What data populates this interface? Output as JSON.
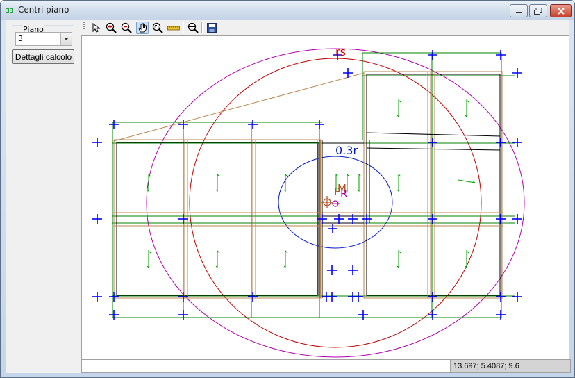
{
  "window": {
    "title": "Centri piano",
    "icon": "app-icon",
    "controls": [
      "minimize-icon",
      "restore-icon",
      "close-icon"
    ]
  },
  "left_panel": {
    "group_label": "Piano",
    "floor_select_value": "3",
    "calc_button_label": "Dettagli calcolo"
  },
  "toolbar": {
    "tools": [
      {
        "name": "select-arrow-icon",
        "active": false
      },
      {
        "name": "zoom-in-icon",
        "active": false
      },
      {
        "name": "zoom-out-icon",
        "active": false
      },
      {
        "name": "pan-hand-icon",
        "active": true
      },
      {
        "name": "zoom-window-icon",
        "active": false
      },
      {
        "name": "measure-ruler-icon",
        "active": false
      },
      {
        "name": "zoom-extents-icon",
        "active": false
      },
      {
        "name": "save-icon",
        "active": false
      }
    ]
  },
  "drawing": {
    "labels": {
      "stiffness_radius": "rs",
      "ellipse_label": "0.3r",
      "mass_center": "M",
      "stiffness_center": "R",
      "point_p": "P"
    },
    "colors": {
      "node_cross": "#0000ff",
      "beam": "#b8864d",
      "grid_line": "#008000",
      "outer_ellipse": "#b000b0",
      "inner_ellipse": "#c00000",
      "small_ellipse": "#0018c8",
      "slab_arrow": "#00a000",
      "rs_label": "#d00000"
    }
  },
  "status": {
    "message": "",
    "coordinates": "13.697; 5.4087; 9.6"
  }
}
